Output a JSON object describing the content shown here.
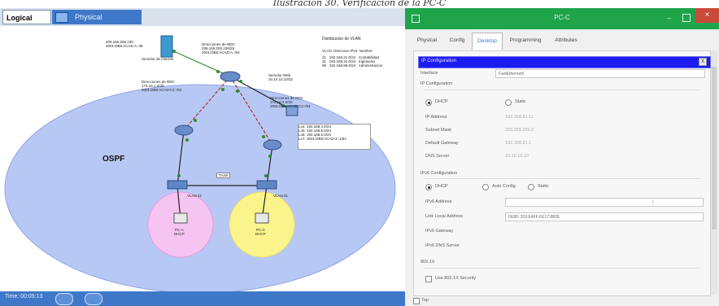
{
  "caption": "Ilustración 30. Verificación de la PC-C",
  "pt": {
    "tab_logical": "Logical",
    "tab_physical": "Physical",
    "cloud_label": "OSPF",
    "server_labels": "209.165.200.230\n2001:DB8:ACAD:A::38",
    "server_name": "Servidor de internet",
    "isp_left_label": "Direcciones de RED\n209.165.200.228/29\n2001:DB8:ACAD:A::/64",
    "isp_right_label": "Servidor Web\n10.10.10.10/32",
    "r1_net_label": "Direcciones de RED\n172.16.1.0/30\n2001:DB8:ACAD:C1::/64",
    "r3_net_label": "Direcciones de RED\n172.16.2.0/30\n2001:DB8:ACAD:C2::/64",
    "loopbacks": "Lo4: 192.168.4.0/24\nLo5: 192.168.5.0/24\nLo6: 192.168.6.0/24\nLo7: 2001:DB8:ACAD:3::1/64",
    "dhcp_title": "Distribucion de VLAN",
    "dhcp_header": "VLAN  Direccion IPv4  Nombre",
    "dhcp_rows": "21   192.168.21.0/24   Contabilidad\n31   192.168.31.0/24   Ingenieria\n99   192.168.99.0/24   Administracion",
    "trunk": "Trunk",
    "vlan21": "VLAN 21",
    "vlan31": "VLAN 31",
    "pca": "PC-A\nDHCP",
    "pcc": "PC-C\nDHCP",
    "status_time": "Time: 00:05:13"
  },
  "dialog": {
    "title": "PC-C",
    "tabs": [
      "Physical",
      "Config",
      "Desktop",
      "Programming",
      "Attributes"
    ],
    "ip_config_header": "IP Configuration",
    "interface_label": "Interface",
    "interface_value": "FastEthernet0",
    "ip_section": "IP Configuration",
    "dhcp": "DHCP",
    "static": "Static",
    "ip_address_label": "IP Address",
    "ip_address": "192.168.31.11",
    "subnet_label": "Subnet Mask",
    "subnet": "255.255.255.0",
    "gateway_label": "Default Gateway",
    "gateway": "192.168.31.1",
    "dns_label": "DNS Server",
    "dns": "10.10.10.10",
    "ipv6_section": "IPv6 Configuration",
    "auto_config": "Auto Config",
    "ipv6_address_label": "IPv6 Address",
    "link_local_label": "Link Local Address",
    "link_local": "FE80::203:E4FF:FE17:8B2E",
    "ipv6_gateway_label": "IPv6 Gateway",
    "ipv6_dns_label": "IPv6 DNS Server",
    "dot1x": "802.1X",
    "use_8021x": "Use 802.1X Security",
    "top": "Top"
  }
}
